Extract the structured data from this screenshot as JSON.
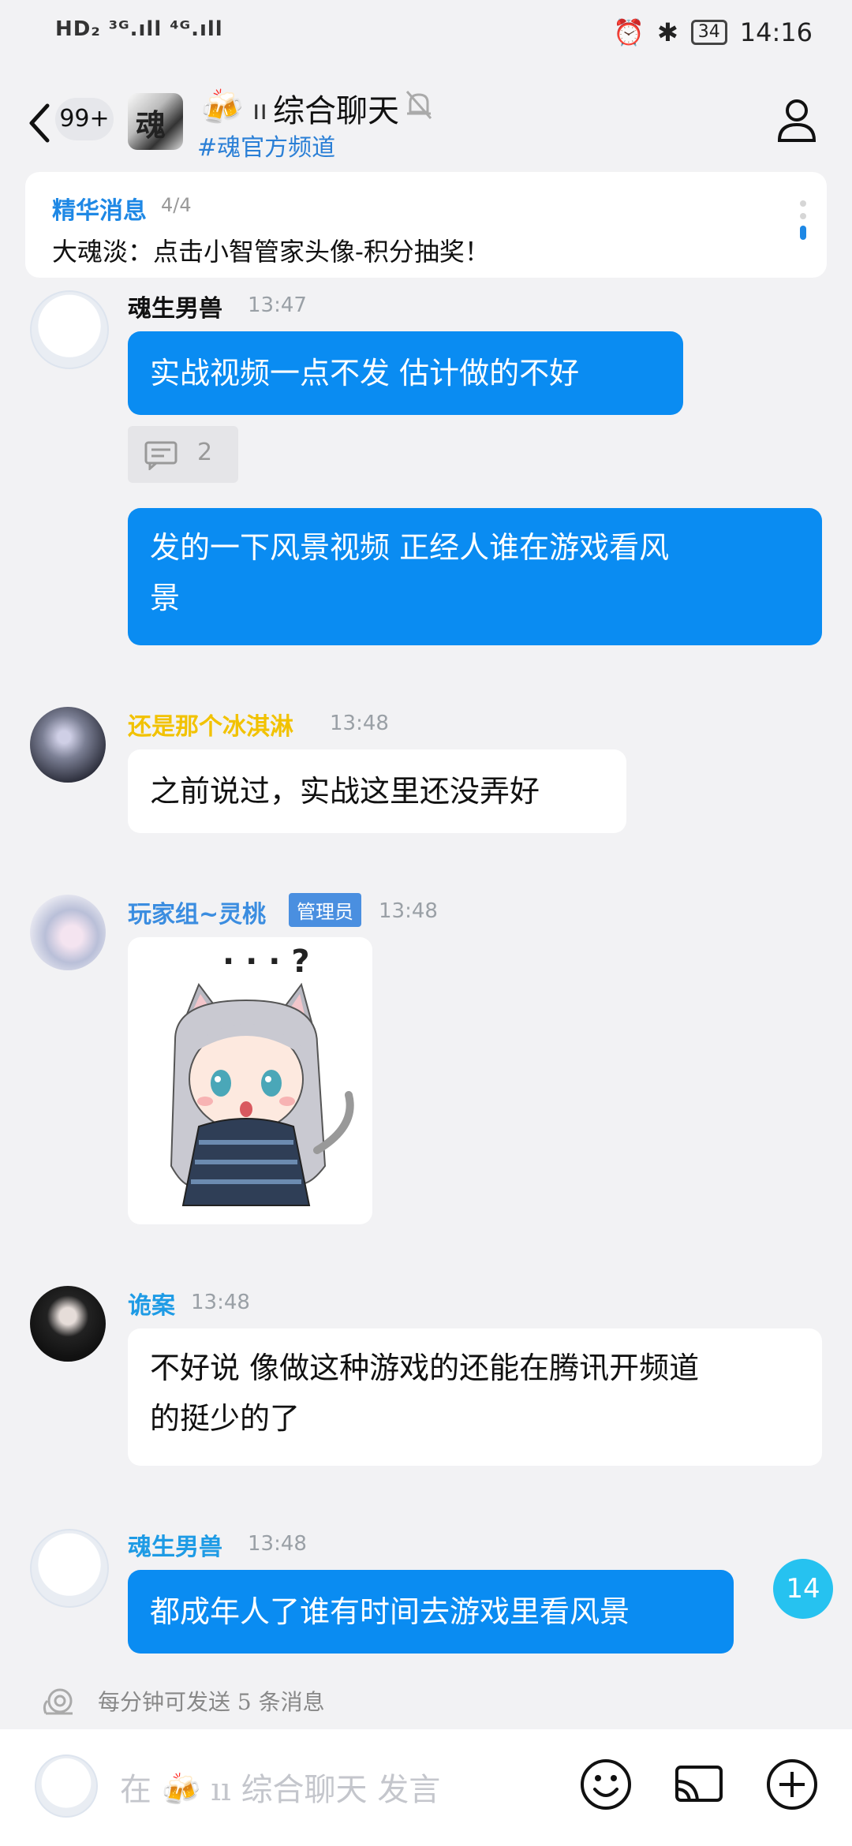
{
  "status": {
    "left": "HD₂ ³ᴳ.ıll ⁴ᴳ.ıll",
    "battery": "34",
    "time": "14:16"
  },
  "header": {
    "unread": "99+",
    "channel_avatar_char": "魂",
    "emoji": "🍻",
    "title": "综合聊天",
    "subtitle": "#魂官方频道"
  },
  "pinned": {
    "label": "精华消息",
    "count": "4/4",
    "text": "大魂淡：点击小智管家头像-积分抽奖！"
  },
  "messages": [
    {
      "sender": "魂生男兽",
      "sender_color": "#1e9be5",
      "time": "13:47",
      "text": "实战视频一点不发 估计做的不好"
    },
    {
      "reply_count": "2"
    },
    {
      "text_line1": "发的一下风景视频 正经人谁在游戏看风",
      "text_line2": "景"
    },
    {
      "sender": "还是那个冰淇淋",
      "sender_color": "#f2c200",
      "time": "13:48",
      "text": "之前说过，实战这里还没弄好"
    },
    {
      "sender": "玩家组~灵桃",
      "sender_color": "#3b8de0",
      "badge": "管理员",
      "time": "13:48",
      "sticker_caption": "· · · ?"
    },
    {
      "sender": "诡案",
      "sender_color": "#1e9be5",
      "time": "13:48",
      "text_line1": "不好说 像做这种游戏的还能在腾讯开频道",
      "text_line2": "的挺少的了"
    },
    {
      "sender": "魂生男兽",
      "sender_color": "#1e9be5",
      "time": "13:48",
      "text": "都成年人了谁有时间去游戏里看风景"
    }
  ],
  "scroll_badge": "14",
  "rate_limit": "每分钟可发送 5 条消息",
  "input": {
    "placeholder_prefix": "在",
    "placeholder_emoji": "🍻",
    "placeholder_channel": "综合聊天",
    "placeholder_suffix": "发言"
  }
}
